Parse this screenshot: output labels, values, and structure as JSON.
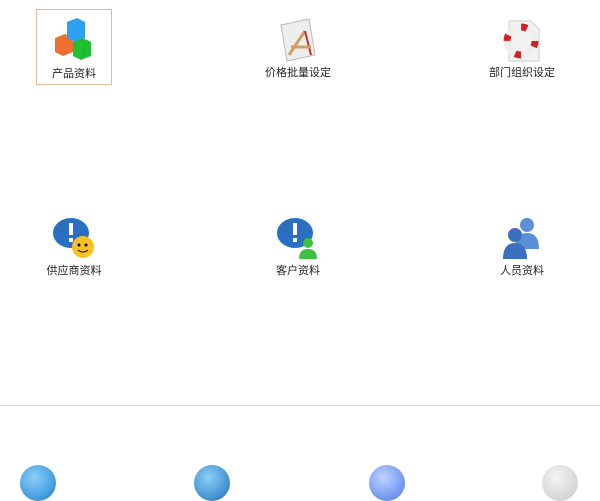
{
  "items": [
    {
      "label": "产品资料",
      "icon": "cubes-icon"
    },
    {
      "label": "价格批量设定",
      "icon": "design-tools-icon"
    },
    {
      "label": "部门组织设定",
      "icon": "lifebuoy-icon"
    },
    {
      "label": "供应商资料",
      "icon": "supplier-chat-icon"
    },
    {
      "label": "客户资料",
      "icon": "customer-chat-icon"
    },
    {
      "label": "人员资料",
      "icon": "users-icon"
    }
  ],
  "bottom_icons": [
    "refresh-globe-icon",
    "globe-tool-icon",
    "blue-orb-icon",
    "gray-disc-icon"
  ]
}
